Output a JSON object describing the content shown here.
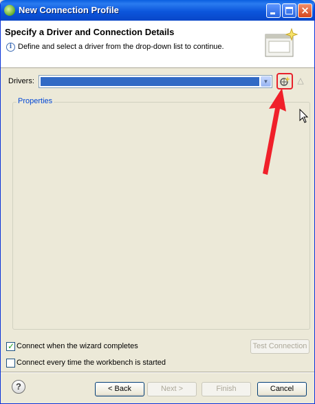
{
  "window": {
    "title": "New Connection Profile"
  },
  "header": {
    "title": "Specify a Driver and Connection Details",
    "description": "Define and select a driver from the drop-down list to continue."
  },
  "drivers": {
    "label": "Drivers:",
    "selected_value": ""
  },
  "properties": {
    "label": "Properties"
  },
  "options": {
    "connect_when_completes": {
      "label": "Connect when the wizard completes",
      "checked": true
    },
    "connect_every_time": {
      "label": "Connect every time the workbench is started",
      "checked": false
    }
  },
  "buttons": {
    "test_connection": "Test Connection",
    "back": "< Back",
    "next": "Next >",
    "finish": "Finish",
    "cancel": "Cancel",
    "help": "?"
  },
  "colors": {
    "titlebar": "#0a5fe0",
    "selection": "#316ac5",
    "annotation": "#e8202a",
    "dialog_bg": "#ece9d8"
  }
}
